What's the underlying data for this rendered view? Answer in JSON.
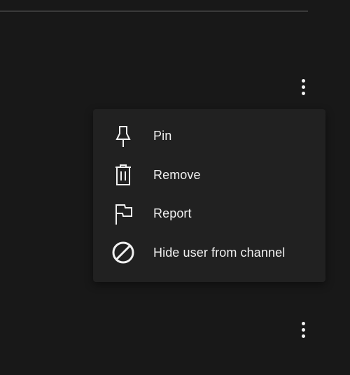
{
  "menu": {
    "items": [
      {
        "label": "Pin",
        "icon": "pin-icon"
      },
      {
        "label": "Remove",
        "icon": "trash-icon"
      },
      {
        "label": "Report",
        "icon": "flag-icon"
      },
      {
        "label": "Hide user from channel",
        "icon": "block-icon"
      }
    ]
  },
  "colors": {
    "background": "#181818",
    "menu_background": "#212121",
    "text": "#f1f1f1"
  }
}
